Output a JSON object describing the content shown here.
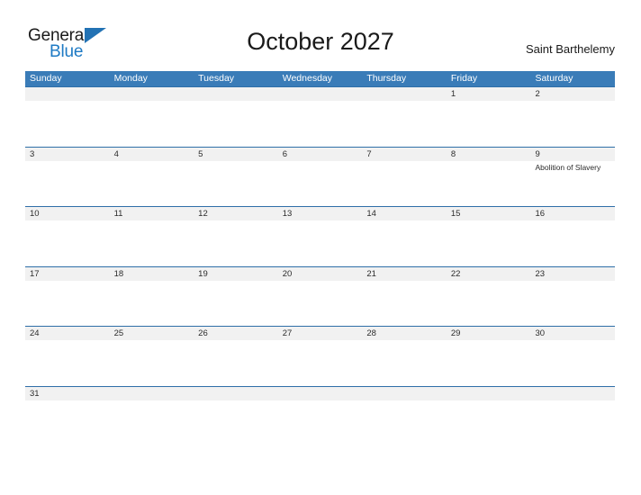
{
  "brand": {
    "name_part1": "General",
    "name_part2": "Blue",
    "flag_icon": "triangle-flag-icon",
    "accent_color": "#1e7ac4"
  },
  "header": {
    "title": "October 2027",
    "location": "Saint Barthelemy"
  },
  "calendar": {
    "header_bg_color": "#3a7cb8",
    "row_border_color": "#2f6fa8",
    "day_band_color": "#f1f1f1",
    "weekdays": [
      "Sunday",
      "Monday",
      "Tuesday",
      "Wednesday",
      "Thursday",
      "Friday",
      "Saturday"
    ],
    "weeks": [
      {
        "days": [
          {
            "num": "",
            "event": ""
          },
          {
            "num": "",
            "event": ""
          },
          {
            "num": "",
            "event": ""
          },
          {
            "num": "",
            "event": ""
          },
          {
            "num": "",
            "event": ""
          },
          {
            "num": "1",
            "event": ""
          },
          {
            "num": "2",
            "event": ""
          }
        ]
      },
      {
        "days": [
          {
            "num": "3",
            "event": ""
          },
          {
            "num": "4",
            "event": ""
          },
          {
            "num": "5",
            "event": ""
          },
          {
            "num": "6",
            "event": ""
          },
          {
            "num": "7",
            "event": ""
          },
          {
            "num": "8",
            "event": ""
          },
          {
            "num": "9",
            "event": "Abolition of Slavery"
          }
        ]
      },
      {
        "days": [
          {
            "num": "10",
            "event": ""
          },
          {
            "num": "11",
            "event": ""
          },
          {
            "num": "12",
            "event": ""
          },
          {
            "num": "13",
            "event": ""
          },
          {
            "num": "14",
            "event": ""
          },
          {
            "num": "15",
            "event": ""
          },
          {
            "num": "16",
            "event": ""
          }
        ]
      },
      {
        "days": [
          {
            "num": "17",
            "event": ""
          },
          {
            "num": "18",
            "event": ""
          },
          {
            "num": "19",
            "event": ""
          },
          {
            "num": "20",
            "event": ""
          },
          {
            "num": "21",
            "event": ""
          },
          {
            "num": "22",
            "event": ""
          },
          {
            "num": "23",
            "event": ""
          }
        ]
      },
      {
        "days": [
          {
            "num": "24",
            "event": ""
          },
          {
            "num": "25",
            "event": ""
          },
          {
            "num": "26",
            "event": ""
          },
          {
            "num": "27",
            "event": ""
          },
          {
            "num": "28",
            "event": ""
          },
          {
            "num": "29",
            "event": ""
          },
          {
            "num": "30",
            "event": ""
          }
        ]
      },
      {
        "days": [
          {
            "num": "31",
            "event": ""
          },
          {
            "num": "",
            "event": ""
          },
          {
            "num": "",
            "event": ""
          },
          {
            "num": "",
            "event": ""
          },
          {
            "num": "",
            "event": ""
          },
          {
            "num": "",
            "event": ""
          },
          {
            "num": "",
            "event": ""
          }
        ]
      }
    ]
  }
}
